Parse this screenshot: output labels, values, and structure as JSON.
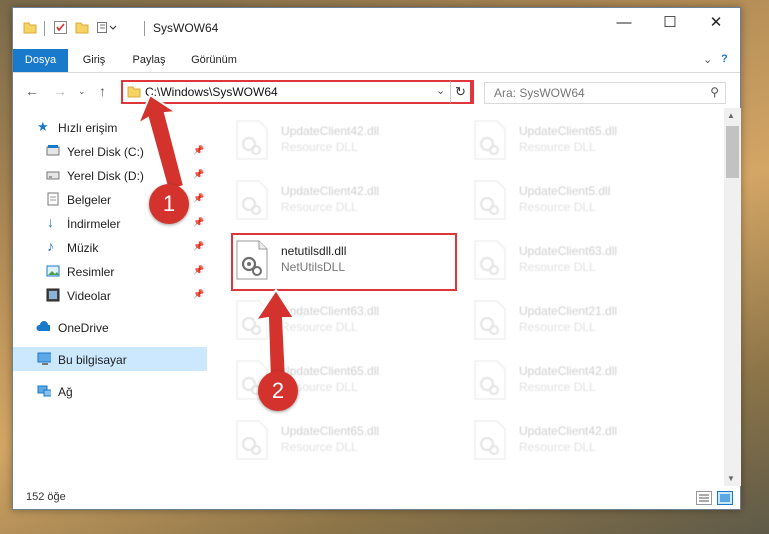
{
  "window": {
    "title": "SysWOW64"
  },
  "ribbon": {
    "tabs": [
      {
        "label": "Dosya",
        "active": true
      },
      {
        "label": "Giriş",
        "active": false
      },
      {
        "label": "Paylaş",
        "active": false
      },
      {
        "label": "Görünüm",
        "active": false
      }
    ]
  },
  "address": {
    "path": "C:\\Windows\\SysWOW64"
  },
  "search": {
    "placeholder": "Ara: SysWOW64"
  },
  "nav": {
    "items": [
      {
        "label": "Hızlı erişim",
        "icon": "star-icon"
      },
      {
        "label": "Yerel Disk (C:)",
        "icon": "drive-icon"
      },
      {
        "label": "Yerel Disk (D:)",
        "icon": "drive-icon"
      },
      {
        "label": "Belgeler",
        "icon": "document-icon"
      },
      {
        "label": "İndirmeler",
        "icon": "download-icon"
      },
      {
        "label": "Müzik",
        "icon": "music-icon"
      },
      {
        "label": "Resimler",
        "icon": "pictures-icon"
      },
      {
        "label": "Videolar",
        "icon": "videos-icon"
      },
      {
        "label": "OneDrive",
        "icon": "cloud-icon"
      },
      {
        "label": "Bu bilgisayar",
        "icon": "computer-icon"
      },
      {
        "label": "Ağ",
        "icon": "network-icon"
      }
    ]
  },
  "files": [
    {
      "name": "UpdateClient42.dll",
      "type": "Resource DLL"
    },
    {
      "name": "UpdateClient65.dll",
      "type": "Resource DLL"
    },
    {
      "name": "UpdateClient42.dll",
      "type": "Resource DLL"
    },
    {
      "name": "UpdateClient5.dll",
      "type": "Resource DLL"
    },
    {
      "name": "netutilsdll.dll",
      "type": "NetUtilsDLL"
    },
    {
      "name": "UpdateClient63.dll",
      "type": "Resource DLL"
    },
    {
      "name": "UpdateClient63.dll",
      "type": "Resource DLL"
    },
    {
      "name": "UpdateClient21.dll",
      "type": "Resource DLL"
    },
    {
      "name": "UpdateClient65.dll",
      "type": "Resource DLL"
    },
    {
      "name": "UpdateClient42.dll",
      "type": "Resource DLL"
    },
    {
      "name": "UpdateClient65.dll",
      "type": "Resource DLL"
    },
    {
      "name": "UpdateClient42.dll",
      "type": "Resource DLL"
    }
  ],
  "status": {
    "count": "152 öğe"
  },
  "callouts": {
    "one": "1",
    "two": "2"
  },
  "colors": {
    "accent": "#1979ca",
    "highlight": "#e0353b",
    "selected": "#cce8ff"
  }
}
